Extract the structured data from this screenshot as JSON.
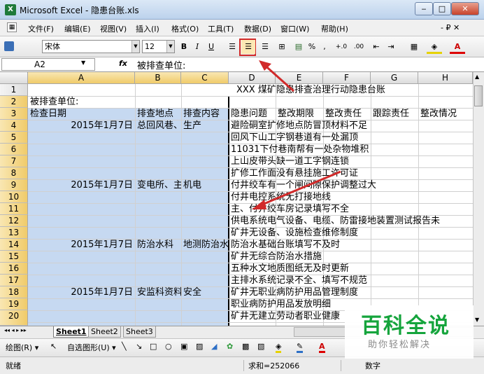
{
  "window": {
    "title": "Microsoft Excel - 隐患台账.xls",
    "icon": "excel-icon",
    "minimize": "‒",
    "restore": "□",
    "close": "✕"
  },
  "menubar": {
    "items": [
      "文件(F)",
      "编辑(E)",
      "视图(V)",
      "插入(I)",
      "格式(O)",
      "工具(T)",
      "数据(D)",
      "窗口(W)",
      "帮助(H)"
    ],
    "doc_close": "- ₽ ✕"
  },
  "toolbar": {
    "font_name": "宋体",
    "font_size": "12",
    "bold": "B",
    "italic": "I",
    "underline": "U",
    "percent": "%",
    "comma": ",",
    "inc_decimal": "+.0",
    "dec_decimal": ".00"
  },
  "formula": {
    "cell_ref": "A2",
    "fx": "fx",
    "content": "被排查单位:"
  },
  "columns": [
    "A",
    "B",
    "C",
    "D",
    "E",
    "F",
    "G",
    "H"
  ],
  "rows": [
    "1",
    "2",
    "3",
    "4",
    "5",
    "6",
    "7",
    "8",
    "9",
    "10",
    "11",
    "12",
    "13",
    "14",
    "15",
    "16",
    "17",
    "18",
    "19",
    "20"
  ],
  "cells": {
    "title": "XXX 煤矿隐患排查治理行动隐患台账",
    "unit_label": "被排查单位:",
    "h_date": "检查日期",
    "h_place": "排查地点",
    "h_content": "排查内容",
    "h_issue": "隐患问题",
    "h_deadline": "整改期限",
    "h_resp1": "整改责任",
    "h_resp2": "跟踪责任",
    "h_status": "整改情况",
    "d4": "2015年1月7日",
    "b4": "总回风巷、",
    "c4": "生产",
    "e4": "避险硐室扩修地点防冒顶材料不足",
    "e5": "回风下山工字钢巷道有一处漏顶",
    "e6": "11031下付巷南帮有一处杂物堆积",
    "e7": "上山皮带头缺一道工字钢连锁",
    "e8": "扩修工作面没有悬挂施工许可证",
    "d9": "2015年1月7日",
    "b9": "变电所、主",
    "c9": "机电",
    "e9": "付井绞车有一个闸间隙保护调整过大",
    "e10": "付井电控系统无打接地线",
    "e11": "主、付井绞车房记录填写不全",
    "e12": "供电系统电气设备、电缆、防雷接地装置测试报告未",
    "e13": "矿井无设备、设施检查维修制度",
    "d14": "2015年1月7日",
    "b14": "防治水科",
    "c14": "地测防治水",
    "e14": "防治水基础台账填写不及时",
    "e15": "矿井无综合防治水措施",
    "e16": "五种水文地质图纸无及时更新",
    "e17": "主排水系统记录不全、填写不规范",
    "d18": "2015年1月7日",
    "b18": "安监科资料",
    "c18": "安全",
    "e18": "矿井无职业病防护用品管理制度",
    "e19": "职业病防护用品发放明细",
    "e20": "矿井无建立劳动者职业健康"
  },
  "sheets": {
    "nav": "◂◂ ◂ ▸ ▸▸",
    "tab1": "Sheet1",
    "tab2": "Sheet2",
    "tab3": "Sheet3"
  },
  "drawbar": {
    "draw": "绘图(R) ▾",
    "autoshapes": "自选图形(U) ▾"
  },
  "status": {
    "ready": "就绪",
    "sum": "求和=252066",
    "num": "数字"
  },
  "watermark": {
    "title": "百科全说",
    "subtitle": "助你轻松解决"
  },
  "colors": {
    "annotation": "#d12a2a",
    "selection": "#c6d9f1",
    "brand": "#15a43c"
  }
}
